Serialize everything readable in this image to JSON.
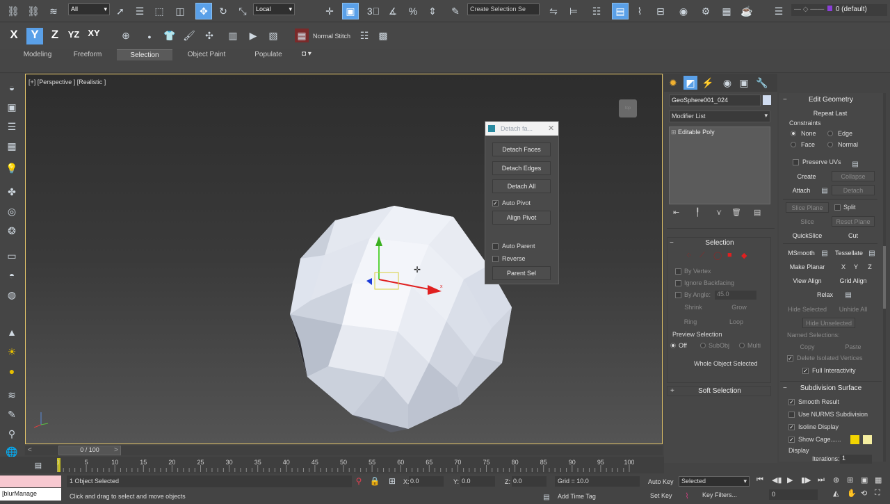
{
  "toolbar": {
    "filter_select": "All",
    "coord_select": "Local",
    "named_selection_placeholder": "Create Selection Se",
    "layer_label": "0 (default)",
    "stitch_label": "Normal Stitch"
  },
  "ribbon_tabs": [
    {
      "label": "Modeling"
    },
    {
      "label": "Freeform"
    },
    {
      "label": "Selection"
    },
    {
      "label": "Object Paint"
    },
    {
      "label": "Populate"
    }
  ],
  "viewport": {
    "label": "[+] [Perspective ] [Realistic ]",
    "time_slider_label": "0 / 100"
  },
  "detach_dialog": {
    "title": "Detach fa...",
    "detach_faces": "Detach Faces",
    "detach_edges": "Detach Edges",
    "detach_all": "Detach All",
    "auto_pivot": "Auto Pivot",
    "align_pivot": "Align Pivot",
    "auto_parent": "Auto Parent",
    "reverse": "Reverse",
    "parent_sel": "Parent Sel"
  },
  "command_panel": {
    "object_name": "GeoSphere001_024",
    "modifier_list": "Modifier List",
    "stack_item": "Editable Poly",
    "selection": {
      "title": "Selection",
      "by_vertex": "By Vertex",
      "ignore_backfacing": "Ignore Backfacing",
      "by_angle": "By Angle:",
      "angle_value": "45.0",
      "shrink": "Shrink",
      "grow": "Grow",
      "ring": "Ring",
      "loop": "Loop",
      "preview_title": "Preview Selection",
      "off": "Off",
      "subobj": "SubObj",
      "multi": "Multi",
      "status": "Whole Object Selected"
    },
    "soft_selection": "Soft Selection"
  },
  "edit_geometry": {
    "title": "Edit Geometry",
    "repeat_last": "Repeat Last",
    "constraints": "Constraints",
    "none": "None",
    "edge": "Edge",
    "face": "Face",
    "normal": "Normal",
    "preserve_uvs": "Preserve UVs",
    "create": "Create",
    "collapse": "Collapse",
    "attach": "Attach",
    "detach": "Detach",
    "slice_plane": "Slice Plane",
    "split": "Split",
    "slice": "Slice",
    "reset_plane": "Reset Plane",
    "quickslice": "QuickSlice",
    "cut": "Cut",
    "msmooth": "MSmooth",
    "tessellate": "Tessellate",
    "make_planar": "Make Planar",
    "x": "X",
    "y": "Y",
    "z": "Z",
    "view_align": "View Align",
    "grid_align": "Grid Align",
    "relax": "Relax",
    "hide_selected": "Hide Selected",
    "unhide_all": "Unhide All",
    "hide_unselected": "Hide Unselected",
    "named_selections": "Named Selections:",
    "copy": "Copy",
    "paste": "Paste",
    "delete_isolated": "Delete Isolated Vertices",
    "full_interactivity": "Full Interactivity"
  },
  "subdivision": {
    "title": "Subdivision Surface",
    "smooth_result": "Smooth Result",
    "use_nurms": "Use NURMS Subdivision",
    "isoline": "Isoline Display",
    "show_cage": "Show Cage......",
    "display": "Display",
    "iterations_label": "Iterations:",
    "iterations": "1"
  },
  "timeline_ticks": [
    "0",
    "5",
    "10",
    "15",
    "20",
    "25",
    "30",
    "35",
    "40",
    "45",
    "50",
    "55",
    "60",
    "65",
    "70",
    "75",
    "80",
    "85",
    "90",
    "95",
    "100"
  ],
  "status": {
    "maxscript": "[blurManage",
    "selected": "1 Object Selected",
    "prompt": "Click and drag to select and move objects",
    "x": "0.0",
    "y": "0.0",
    "z": "0.0",
    "grid": "Grid = 10.0",
    "add_time_tag": "Add Time Tag",
    "auto_key": "Auto Key",
    "set_key": "Set Key",
    "key_mode": "Selected",
    "key_filters": "Key Filters...",
    "frame": "0"
  },
  "colors": {
    "accent": "#5aa0e8",
    "viewport_border": "#e8c86a",
    "cage_yellow": "#f2d400",
    "cage_light": "#f5eea0"
  }
}
